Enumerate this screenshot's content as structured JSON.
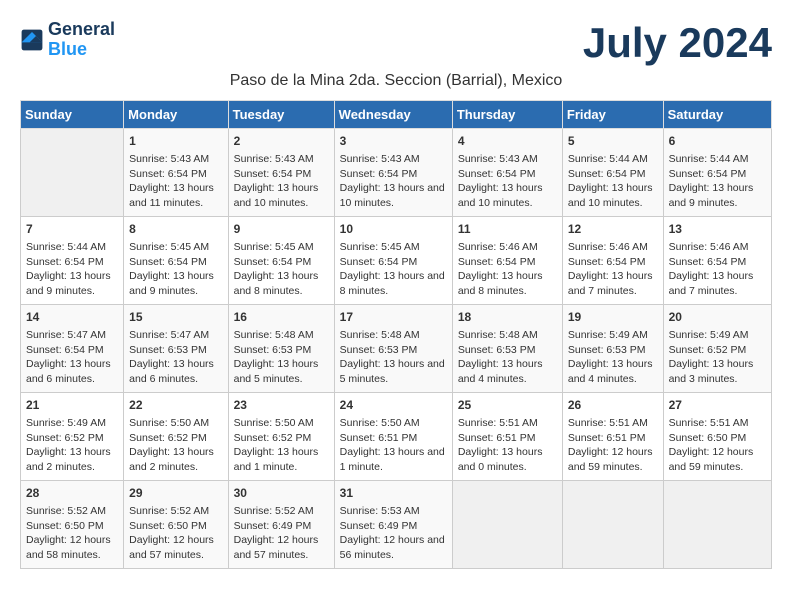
{
  "logo": {
    "general": "General",
    "blue": "Blue"
  },
  "header": {
    "month": "July 2024",
    "location": "Paso de la Mina 2da. Seccion (Barrial), Mexico"
  },
  "days_of_week": [
    "Sunday",
    "Monday",
    "Tuesday",
    "Wednesday",
    "Thursday",
    "Friday",
    "Saturday"
  ],
  "weeks": [
    [
      {
        "day": "",
        "empty": true
      },
      {
        "day": "1",
        "sunrise": "Sunrise: 5:43 AM",
        "sunset": "Sunset: 6:54 PM",
        "daylight": "Daylight: 13 hours and 11 minutes."
      },
      {
        "day": "2",
        "sunrise": "Sunrise: 5:43 AM",
        "sunset": "Sunset: 6:54 PM",
        "daylight": "Daylight: 13 hours and 10 minutes."
      },
      {
        "day": "3",
        "sunrise": "Sunrise: 5:43 AM",
        "sunset": "Sunset: 6:54 PM",
        "daylight": "Daylight: 13 hours and 10 minutes."
      },
      {
        "day": "4",
        "sunrise": "Sunrise: 5:43 AM",
        "sunset": "Sunset: 6:54 PM",
        "daylight": "Daylight: 13 hours and 10 minutes."
      },
      {
        "day": "5",
        "sunrise": "Sunrise: 5:44 AM",
        "sunset": "Sunset: 6:54 PM",
        "daylight": "Daylight: 13 hours and 10 minutes."
      },
      {
        "day": "6",
        "sunrise": "Sunrise: 5:44 AM",
        "sunset": "Sunset: 6:54 PM",
        "daylight": "Daylight: 13 hours and 9 minutes."
      }
    ],
    [
      {
        "day": "7",
        "sunrise": "Sunrise: 5:44 AM",
        "sunset": "Sunset: 6:54 PM",
        "daylight": "Daylight: 13 hours and 9 minutes."
      },
      {
        "day": "8",
        "sunrise": "Sunrise: 5:45 AM",
        "sunset": "Sunset: 6:54 PM",
        "daylight": "Daylight: 13 hours and 9 minutes."
      },
      {
        "day": "9",
        "sunrise": "Sunrise: 5:45 AM",
        "sunset": "Sunset: 6:54 PM",
        "daylight": "Daylight: 13 hours and 8 minutes."
      },
      {
        "day": "10",
        "sunrise": "Sunrise: 5:45 AM",
        "sunset": "Sunset: 6:54 PM",
        "daylight": "Daylight: 13 hours and 8 minutes."
      },
      {
        "day": "11",
        "sunrise": "Sunrise: 5:46 AM",
        "sunset": "Sunset: 6:54 PM",
        "daylight": "Daylight: 13 hours and 8 minutes."
      },
      {
        "day": "12",
        "sunrise": "Sunrise: 5:46 AM",
        "sunset": "Sunset: 6:54 PM",
        "daylight": "Daylight: 13 hours and 7 minutes."
      },
      {
        "day": "13",
        "sunrise": "Sunrise: 5:46 AM",
        "sunset": "Sunset: 6:54 PM",
        "daylight": "Daylight: 13 hours and 7 minutes."
      }
    ],
    [
      {
        "day": "14",
        "sunrise": "Sunrise: 5:47 AM",
        "sunset": "Sunset: 6:54 PM",
        "daylight": "Daylight: 13 hours and 6 minutes."
      },
      {
        "day": "15",
        "sunrise": "Sunrise: 5:47 AM",
        "sunset": "Sunset: 6:53 PM",
        "daylight": "Daylight: 13 hours and 6 minutes."
      },
      {
        "day": "16",
        "sunrise": "Sunrise: 5:48 AM",
        "sunset": "Sunset: 6:53 PM",
        "daylight": "Daylight: 13 hours and 5 minutes."
      },
      {
        "day": "17",
        "sunrise": "Sunrise: 5:48 AM",
        "sunset": "Sunset: 6:53 PM",
        "daylight": "Daylight: 13 hours and 5 minutes."
      },
      {
        "day": "18",
        "sunrise": "Sunrise: 5:48 AM",
        "sunset": "Sunset: 6:53 PM",
        "daylight": "Daylight: 13 hours and 4 minutes."
      },
      {
        "day": "19",
        "sunrise": "Sunrise: 5:49 AM",
        "sunset": "Sunset: 6:53 PM",
        "daylight": "Daylight: 13 hours and 4 minutes."
      },
      {
        "day": "20",
        "sunrise": "Sunrise: 5:49 AM",
        "sunset": "Sunset: 6:52 PM",
        "daylight": "Daylight: 13 hours and 3 minutes."
      }
    ],
    [
      {
        "day": "21",
        "sunrise": "Sunrise: 5:49 AM",
        "sunset": "Sunset: 6:52 PM",
        "daylight": "Daylight: 13 hours and 2 minutes."
      },
      {
        "day": "22",
        "sunrise": "Sunrise: 5:50 AM",
        "sunset": "Sunset: 6:52 PM",
        "daylight": "Daylight: 13 hours and 2 minutes."
      },
      {
        "day": "23",
        "sunrise": "Sunrise: 5:50 AM",
        "sunset": "Sunset: 6:52 PM",
        "daylight": "Daylight: 13 hours and 1 minute."
      },
      {
        "day": "24",
        "sunrise": "Sunrise: 5:50 AM",
        "sunset": "Sunset: 6:51 PM",
        "daylight": "Daylight: 13 hours and 1 minute."
      },
      {
        "day": "25",
        "sunrise": "Sunrise: 5:51 AM",
        "sunset": "Sunset: 6:51 PM",
        "daylight": "Daylight: 13 hours and 0 minutes."
      },
      {
        "day": "26",
        "sunrise": "Sunrise: 5:51 AM",
        "sunset": "Sunset: 6:51 PM",
        "daylight": "Daylight: 12 hours and 59 minutes."
      },
      {
        "day": "27",
        "sunrise": "Sunrise: 5:51 AM",
        "sunset": "Sunset: 6:50 PM",
        "daylight": "Daylight: 12 hours and 59 minutes."
      }
    ],
    [
      {
        "day": "28",
        "sunrise": "Sunrise: 5:52 AM",
        "sunset": "Sunset: 6:50 PM",
        "daylight": "Daylight: 12 hours and 58 minutes."
      },
      {
        "day": "29",
        "sunrise": "Sunrise: 5:52 AM",
        "sunset": "Sunset: 6:50 PM",
        "daylight": "Daylight: 12 hours and 57 minutes."
      },
      {
        "day": "30",
        "sunrise": "Sunrise: 5:52 AM",
        "sunset": "Sunset: 6:49 PM",
        "daylight": "Daylight: 12 hours and 57 minutes."
      },
      {
        "day": "31",
        "sunrise": "Sunrise: 5:53 AM",
        "sunset": "Sunset: 6:49 PM",
        "daylight": "Daylight: 12 hours and 56 minutes."
      },
      {
        "day": "",
        "empty": true
      },
      {
        "day": "",
        "empty": true
      },
      {
        "day": "",
        "empty": true
      }
    ]
  ]
}
